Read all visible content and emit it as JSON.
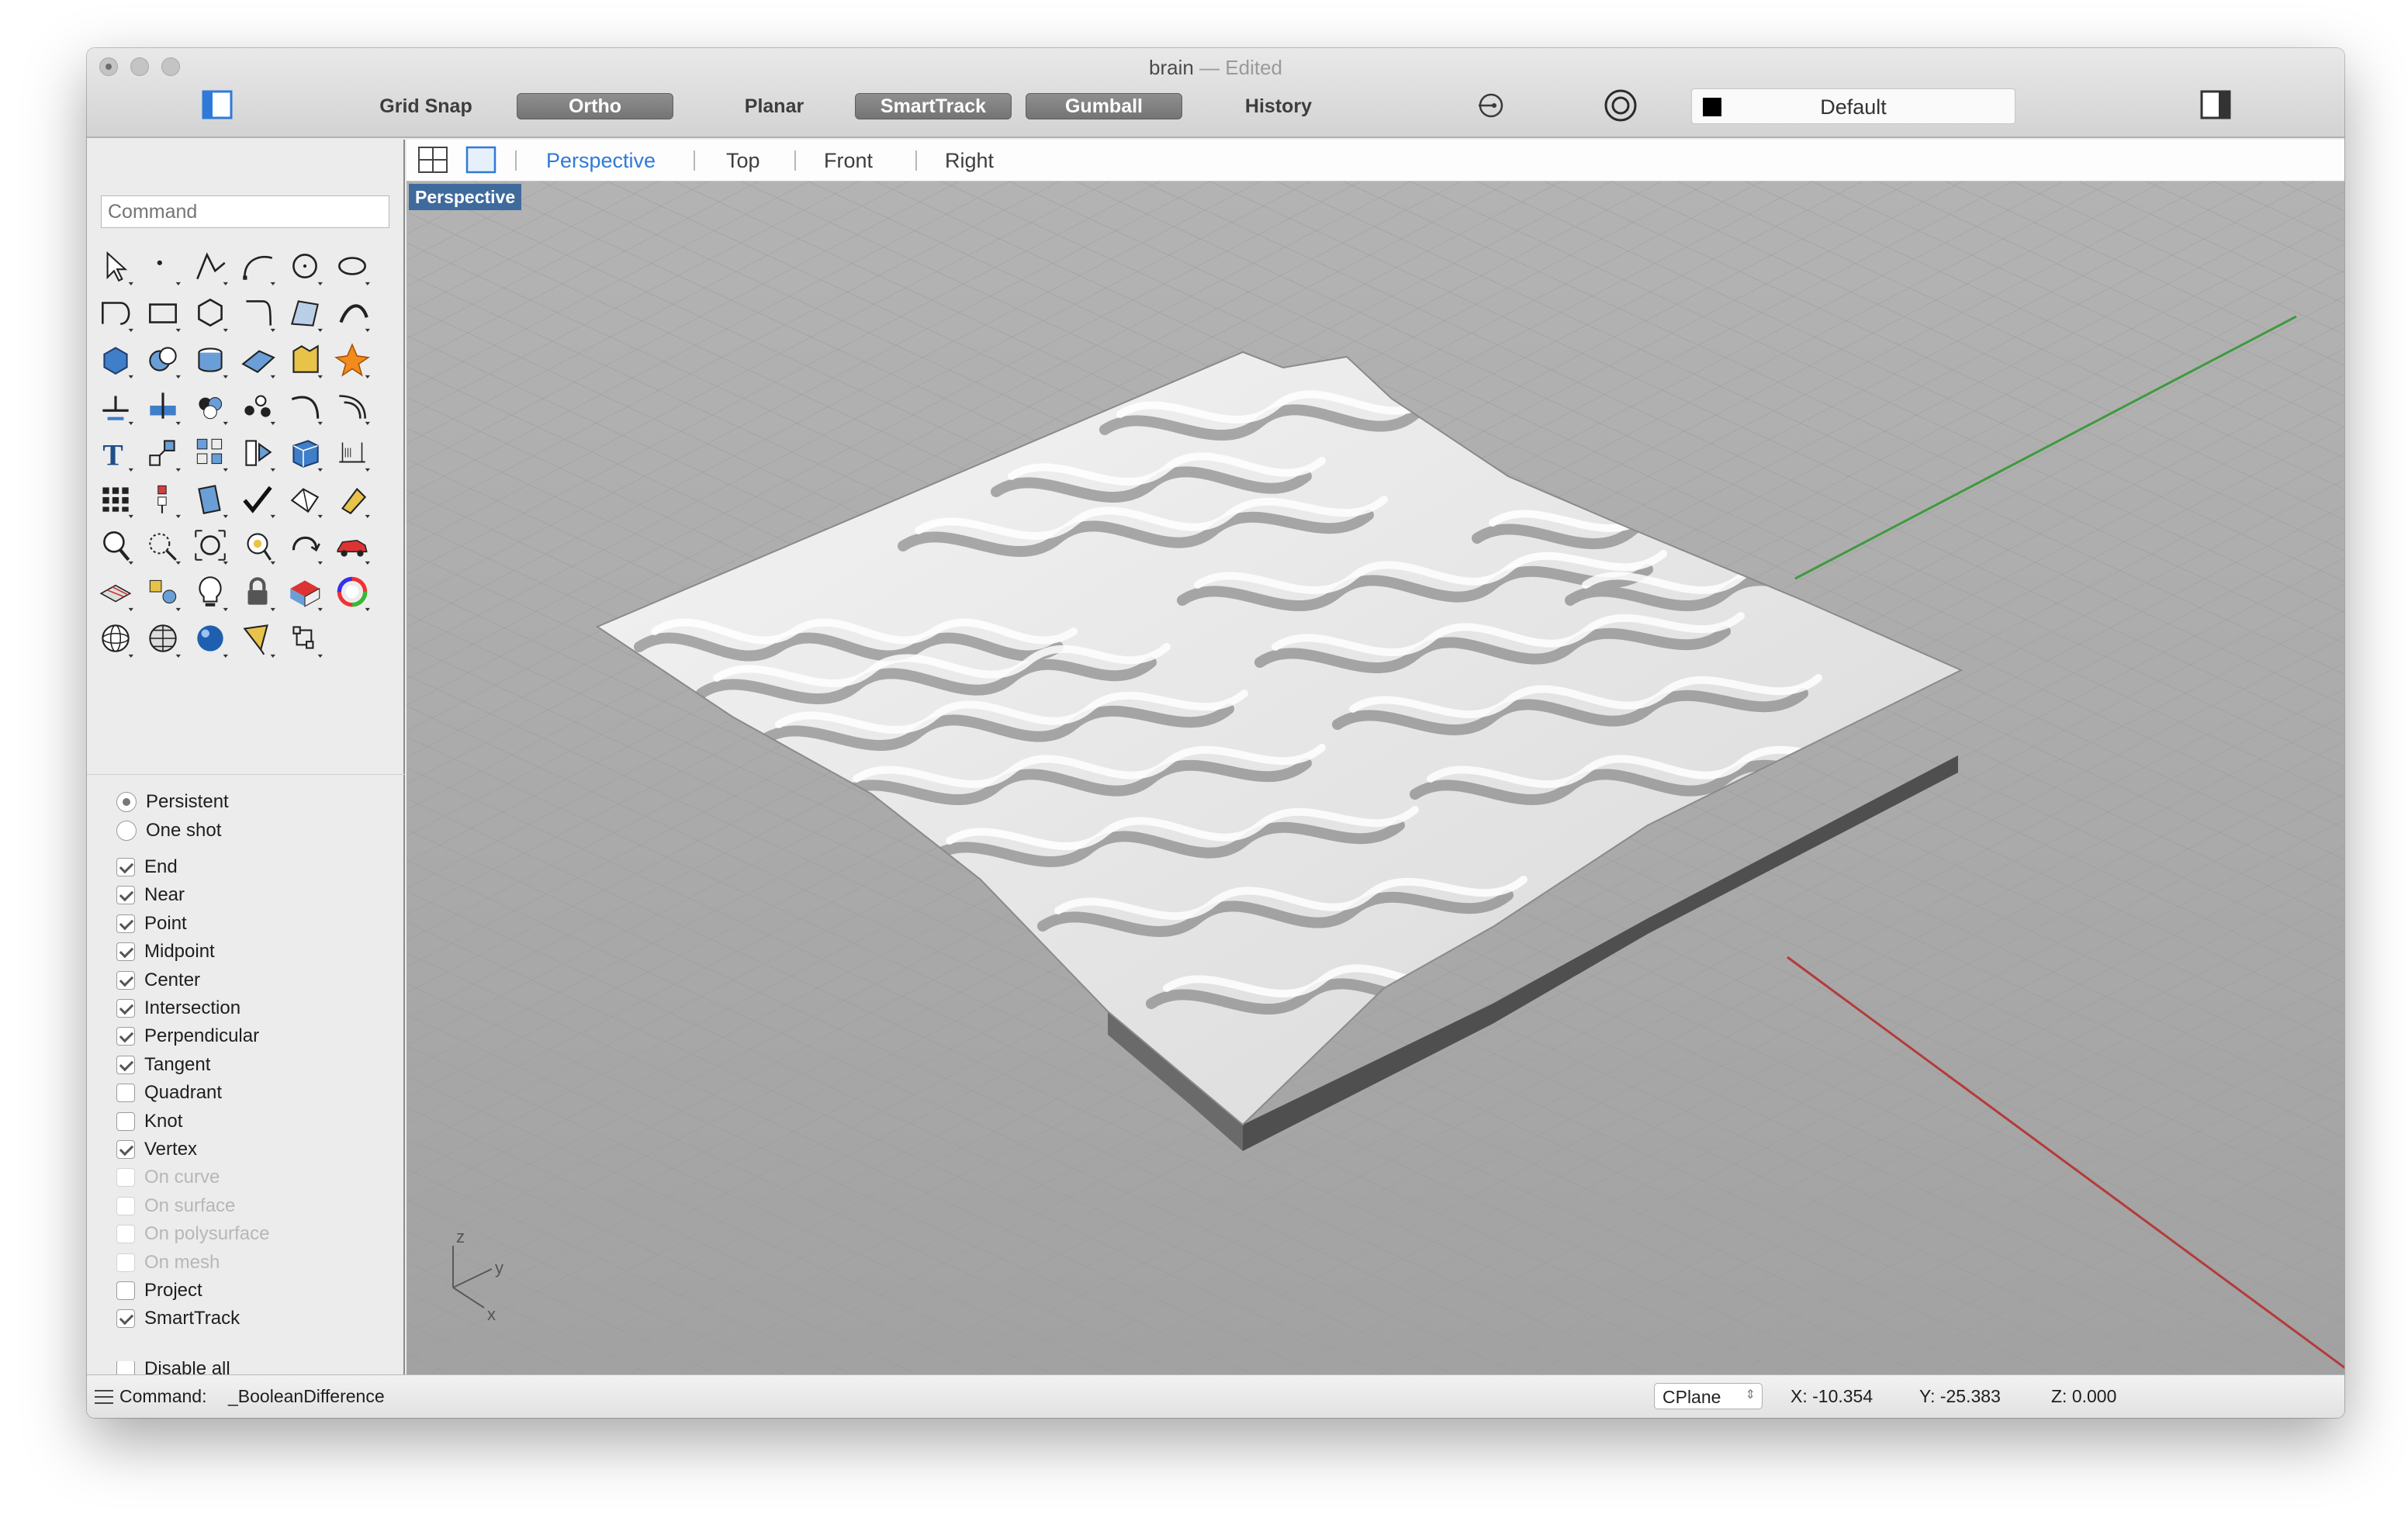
{
  "window": {
    "title": "brain",
    "separator": "—",
    "status": "Edited"
  },
  "toolbar": {
    "grid_snap": "Grid Snap",
    "ortho": "Ortho",
    "planar": "Planar",
    "smarttrack": "SmartTrack",
    "gumball": "Gumball",
    "history": "History",
    "layer": "Default",
    "icons": [
      "sidebar-toggle-icon",
      "record-history-icon",
      "osnap-target-icon",
      "inspector-toggle-icon"
    ]
  },
  "sidebar": {
    "command_placeholder": "Command",
    "osnap": {
      "modes": [
        {
          "label": "Persistent",
          "selected": true
        },
        {
          "label": "One shot",
          "selected": false
        }
      ],
      "items": [
        {
          "label": "End",
          "checked": true,
          "enabled": true
        },
        {
          "label": "Near",
          "checked": true,
          "enabled": true
        },
        {
          "label": "Point",
          "checked": true,
          "enabled": true
        },
        {
          "label": "Midpoint",
          "checked": true,
          "enabled": true
        },
        {
          "label": "Center",
          "checked": true,
          "enabled": true
        },
        {
          "label": "Intersection",
          "checked": true,
          "enabled": true
        },
        {
          "label": "Perpendicular",
          "checked": true,
          "enabled": true
        },
        {
          "label": "Tangent",
          "checked": true,
          "enabled": true
        },
        {
          "label": "Quadrant",
          "checked": false,
          "enabled": true
        },
        {
          "label": "Knot",
          "checked": false,
          "enabled": true
        },
        {
          "label": "Vertex",
          "checked": true,
          "enabled": true
        },
        {
          "label": "On curve",
          "checked": false,
          "enabled": false
        },
        {
          "label": "On surface",
          "checked": false,
          "enabled": false
        },
        {
          "label": "On polysurface",
          "checked": false,
          "enabled": false
        },
        {
          "label": "On mesh",
          "checked": false,
          "enabled": false
        },
        {
          "label": "Project",
          "checked": false,
          "enabled": true
        },
        {
          "label": "SmartTrack",
          "checked": true,
          "enabled": true
        }
      ],
      "disable_all": "Disable all"
    }
  },
  "viewport_tabs": {
    "tabs": [
      "Perspective",
      "Top",
      "Front",
      "Right"
    ],
    "active": "Perspective",
    "icons": [
      "four-viewports-icon",
      "single-viewport-icon"
    ]
  },
  "viewport": {
    "label": "Perspective",
    "axis_labels": {
      "z": "z",
      "y": "y",
      "x": "x"
    },
    "colors": {
      "background": "#a8a8a8",
      "grid": "#9c9c9c",
      "x_axis": "#b53a3a",
      "y_axis": "#3f9a3f",
      "surface": "#e4e4e4",
      "base": "#4f4f4f"
    }
  },
  "status": {
    "command_label": "Command:",
    "command_value": "_BooleanDifference",
    "cplane": "CPlane",
    "x": "X: -10.354",
    "y": "Y: -25.383",
    "z": "Z: 0.000"
  },
  "tools": [
    "select-arrow-icon",
    "point-icon",
    "polyline-icon",
    "curve-icon",
    "circle-icon",
    "arc-icon",
    "curve-from-points-icon",
    "rectangle-icon",
    "polygon-icon",
    "fillet-curve-icon",
    "surface-from-curves-icon",
    "sweep-icon",
    "box-icon",
    "boolean-union-icon",
    "cylinder-icon",
    "plane-surface-icon",
    "solid-tools-icon",
    "explode-icon",
    "trim-icon",
    "split-icon",
    "join-icon",
    "group-icon",
    "fillet-icon",
    "offset-icon",
    "text-icon",
    "transform-icon",
    "array-icon",
    "mirror-icon",
    "solid-box-icon",
    "dimension-icon",
    "grid-array-icon",
    "align-icon",
    "project-icon",
    "check-icon",
    "mesh-icon",
    "paint-icon",
    "zoom-icon",
    "zoom-window-icon",
    "zoom-extents-icon",
    "zoom-selected-icon",
    "rotate-view-icon",
    "car-icon",
    "layers-icon",
    "objects-icon",
    "light-icon",
    "lock-icon",
    "render-icon",
    "color-wheel-icon",
    "sphere-wireframe-icon",
    "sphere-grid-icon",
    "sphere-shaded-icon",
    "camera-icon",
    "dimension-tools-icon"
  ]
}
